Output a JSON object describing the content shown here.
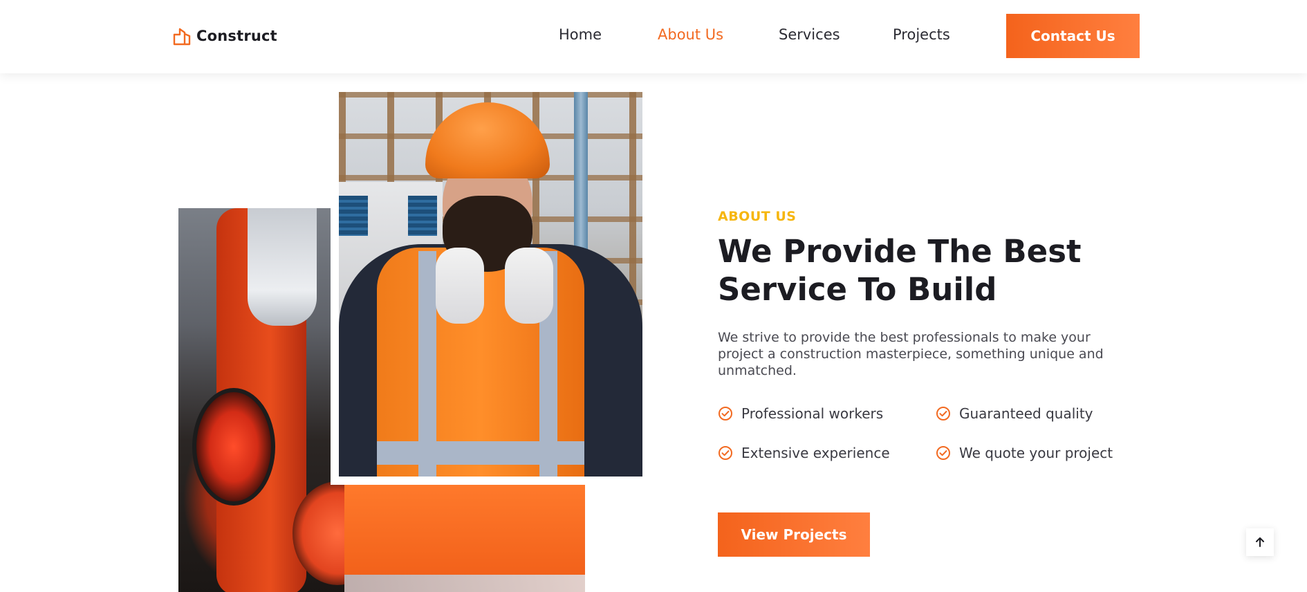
{
  "navbar": {
    "brand": "Construct",
    "links": [
      {
        "label": "Home",
        "active": false
      },
      {
        "label": "About Us",
        "active": true
      },
      {
        "label": "Services",
        "active": false
      },
      {
        "label": "Projects",
        "active": false
      }
    ],
    "cta_label": "Contact Us"
  },
  "about": {
    "eyebrow": "ABOUT US",
    "title_line1": "We Provide The Best",
    "title_line2": "Service To Build",
    "description": "We strive to provide the best professionals to make your project a construction masterpiece, something unique and unmatched.",
    "features": [
      "Professional workers",
      "Guaranteed quality",
      "Extensive experience",
      "We quote your project"
    ],
    "button_label": "View Projects"
  },
  "icons": {
    "brand": "building-logo-icon",
    "feature": "check-circle-icon",
    "scroll": "arrow-up-icon"
  },
  "colors": {
    "accent": "#f26a21",
    "eyebrow": "#f6b60f",
    "heading": "#1c1c22",
    "body": "#4a4a52"
  }
}
